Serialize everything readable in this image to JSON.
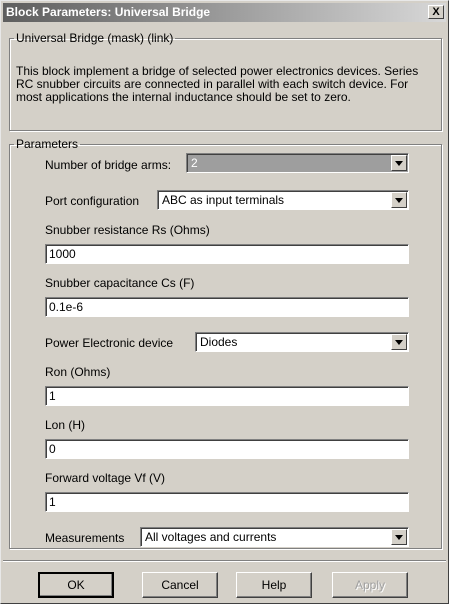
{
  "window": {
    "title": "Block Parameters: Universal Bridge",
    "close_glyph": "X"
  },
  "mask_group": {
    "legend": "Universal Bridge (mask) (link)",
    "description": "This block implement a bridge of selected power electronics devices. Series RC snubber circuits are connected in parallel with each switch device.  For most applications the internal inductance should be set to zero."
  },
  "params_group": {
    "legend": "Parameters",
    "bridge_arms": {
      "label": "Number of bridge arms:",
      "value": "2"
    },
    "port_config": {
      "label": "Port configuration",
      "value": "ABC as input terminals"
    },
    "rs": {
      "label": "Snubber resistance Rs (Ohms)",
      "value": "1000"
    },
    "cs": {
      "label": "Snubber capacitance Cs (F)",
      "value": "0.1e-6"
    },
    "device": {
      "label": "Power Electronic device",
      "value": "Diodes"
    },
    "ron": {
      "label": "Ron (Ohms)",
      "value": "1"
    },
    "lon": {
      "label": "Lon (H)",
      "value": "0"
    },
    "vf": {
      "label": "Forward voltage Vf (V)",
      "value": "1"
    },
    "measurements": {
      "label": "Measurements",
      "value": "All voltages and currents"
    }
  },
  "buttons": {
    "ok": "OK",
    "cancel": "Cancel",
    "help": "Help",
    "apply": "Apply"
  },
  "icons": {
    "dropdown": "chevron-down-icon",
    "close": "close-icon"
  }
}
